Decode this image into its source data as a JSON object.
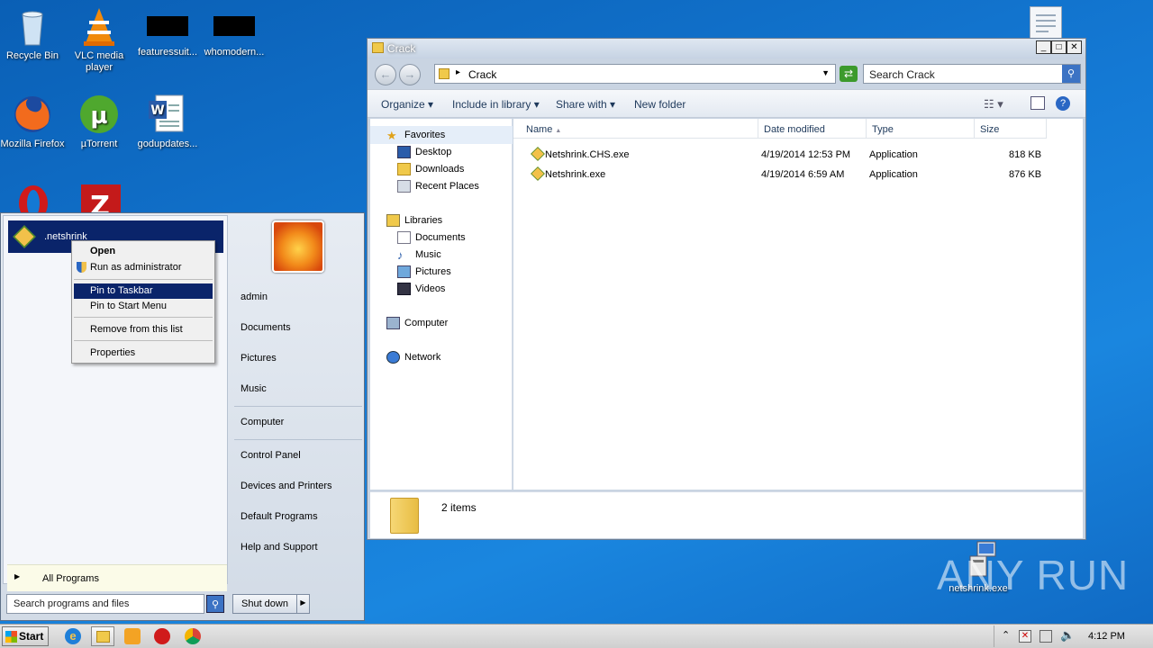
{
  "desktop": {
    "icons": [
      {
        "label": "Recycle Bin",
        "icon": "recycle-bin-icon"
      },
      {
        "label": "VLC media player",
        "icon": "vlc-icon"
      },
      {
        "label": "featuressuit...",
        "icon": "redacted-icon"
      },
      {
        "label": "whomodern...",
        "icon": "redacted-icon"
      },
      {
        "label": "Mozilla Firefox",
        "icon": "firefox-icon"
      },
      {
        "label": "µTorrent",
        "icon": "utorrent-icon"
      },
      {
        "label": "godupdates...",
        "icon": "word-document-icon"
      },
      {
        "label": "netshrink.exe",
        "icon": "netshrink-icon"
      }
    ],
    "watermark": "ANY RUN"
  },
  "explorer": {
    "title": "Crack",
    "address_crumb": "Crack",
    "search_placeholder": "Search Crack",
    "toolbar": {
      "organize": "Organize",
      "include": "Include in library",
      "share": "Share with",
      "new_folder": "New folder"
    },
    "nav": {
      "favorites": "Favorites",
      "desktop": "Desktop",
      "downloads": "Downloads",
      "recent": "Recent Places",
      "libraries": "Libraries",
      "documents": "Documents",
      "music": "Music",
      "pictures": "Pictures",
      "videos": "Videos",
      "computer": "Computer",
      "network": "Network"
    },
    "columns": {
      "name": "Name",
      "date": "Date modified",
      "type": "Type",
      "size": "Size"
    },
    "files": [
      {
        "name": "Netshrink.CHS.exe",
        "date": "4/19/2014 12:53 PM",
        "type": "Application",
        "size": "818 KB"
      },
      {
        "name": "Netshrink.exe",
        "date": "4/19/2014 6:59 AM",
        "type": "Application",
        "size": "876 KB"
      }
    ],
    "status": "2 items"
  },
  "start_menu": {
    "pinned_program": ".netshrink",
    "user": "admin",
    "right_items": [
      "admin",
      "Documents",
      "Pictures",
      "Music",
      "Computer",
      "Control Panel",
      "Devices and Printers",
      "Default Programs",
      "Help and Support"
    ],
    "all_programs": "All Programs",
    "search_placeholder": "Search programs and files",
    "shutdown": "Shut down"
  },
  "context_menu": {
    "items": [
      "Open",
      "Run as administrator",
      "Pin to Taskbar",
      "Pin to Start Menu",
      "Remove from this list",
      "Properties"
    ],
    "highlighted": "Pin to Taskbar"
  },
  "taskbar": {
    "start": "Start",
    "clock": "4:12 PM"
  },
  "colors": {
    "highlight": "#0a246a",
    "desktop": "#1479d4"
  }
}
